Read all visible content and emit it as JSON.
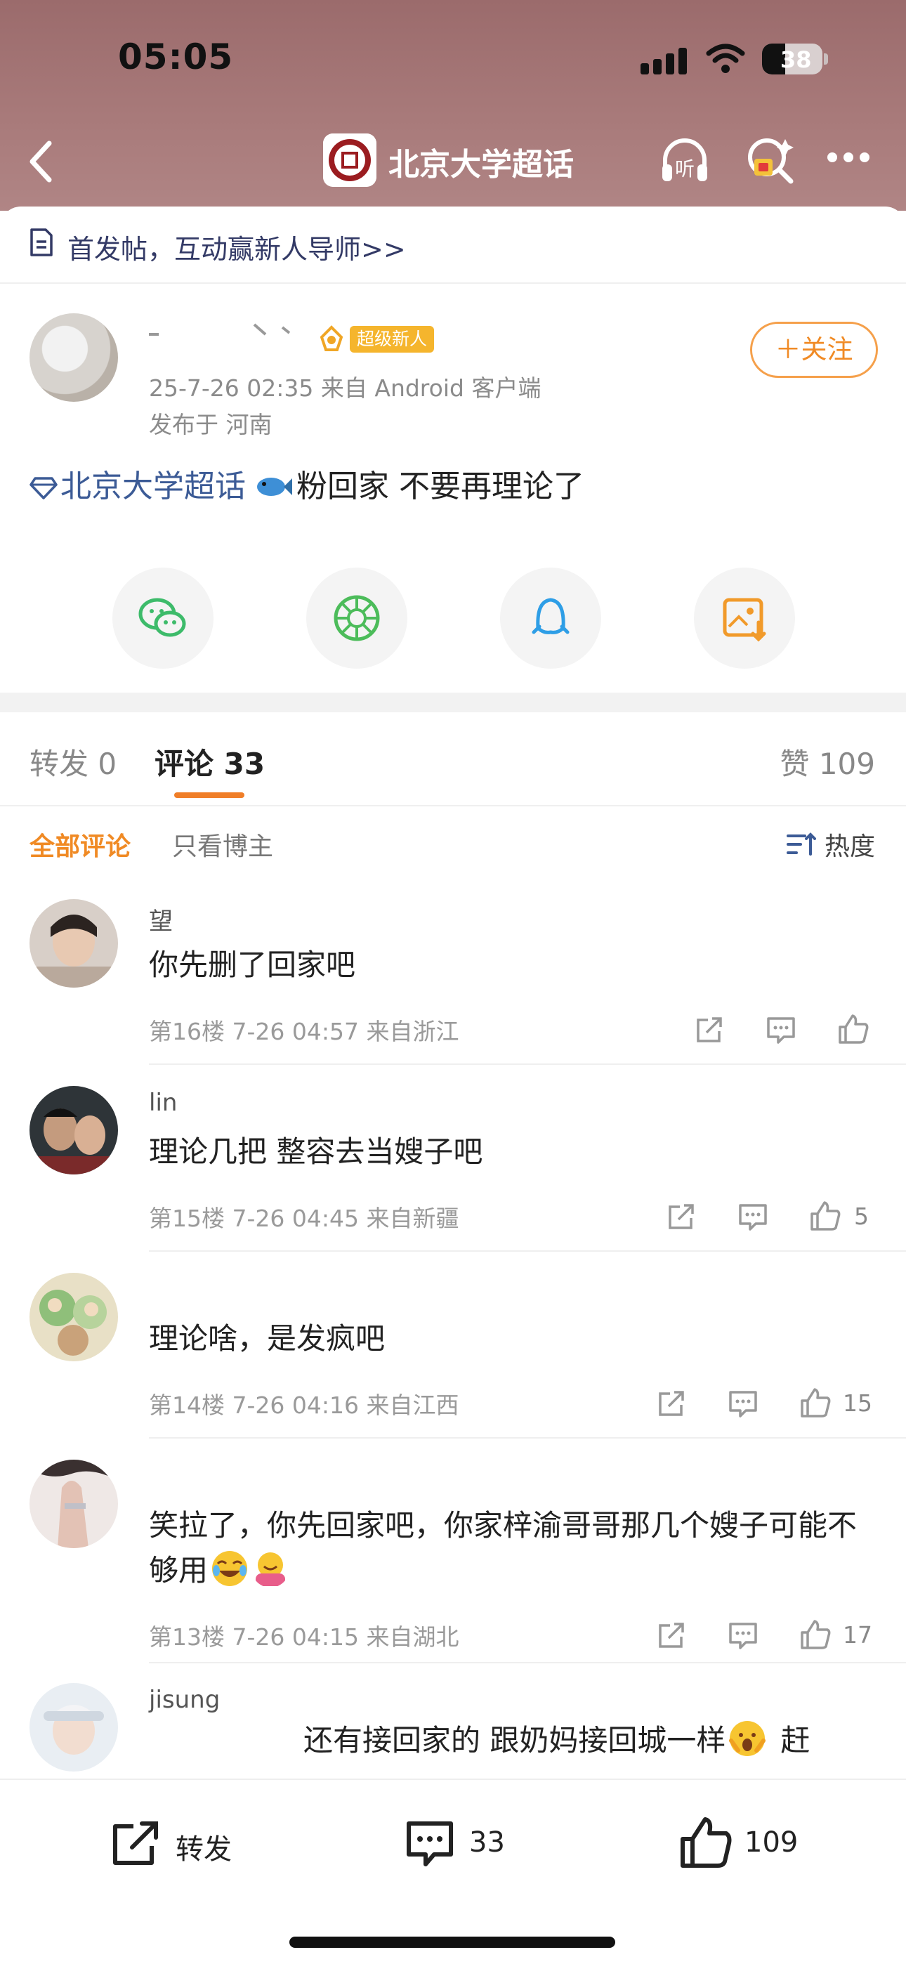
{
  "status_bar": {
    "time": "05:05",
    "battery_percent": "38",
    "battery_level": 0.38
  },
  "nav": {
    "title": "北京大学超话",
    "listen_label": "听"
  },
  "notice": {
    "text": "首发帖，互动赢新人导师>>"
  },
  "post": {
    "badge": "超级新人",
    "meta": "25-7-26 02:35  来自 Android 客户端",
    "location": "发布于 河南",
    "follow_label": "＋关注",
    "topic": "北京大学超话",
    "content": "粉回家 不要再理论了"
  },
  "tabs": {
    "repost": "转发 0",
    "comment": "评论 33",
    "like": "赞 109"
  },
  "filters": {
    "all": "全部评论",
    "author_only": "只看博主",
    "sort": "热度"
  },
  "comments": [
    {
      "name": "望",
      "text": "你先删了回家吧",
      "meta": "第16楼 7-26 04:57 来自浙江",
      "likes": ""
    },
    {
      "name": "lin",
      "text": "理论几把 整容去当嫂子吧",
      "meta": "第15楼 7-26 04:45 来自新疆",
      "likes": "5"
    },
    {
      "name": "",
      "text": "理论啥，是发疯吧",
      "meta": "第14楼 7-26 04:16 来自江西",
      "likes": "15"
    },
    {
      "name": "",
      "text": "笑拉了，你先回家吧，你家梓渝哥哥那几个嫂子可能不够用",
      "meta": "第13楼 7-26 04:15 来自湖北",
      "likes": "17"
    },
    {
      "name": "jisung",
      "text": "还有接回家的 跟奶妈接回城一样",
      "tail": "赶",
      "meta": "",
      "likes": ""
    }
  ],
  "bottom_bar": {
    "repost": "转发",
    "comment": "33",
    "like": "109"
  },
  "colors": {
    "accent": "#f08a24",
    "topic_blue": "#3c5b96",
    "header_bg": "#a57676"
  }
}
